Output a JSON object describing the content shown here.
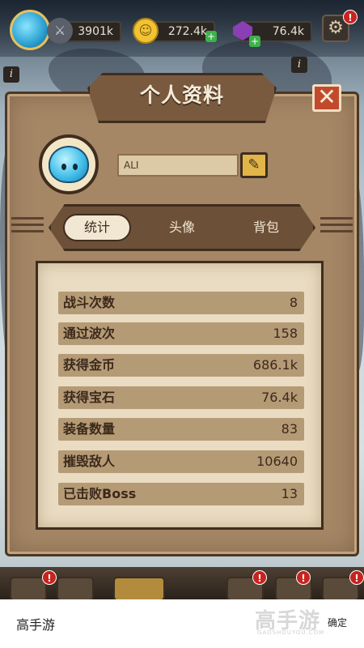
{
  "hud": {
    "power": "3901k",
    "coins": "272.4k",
    "gems": "76.4k",
    "alert": "!",
    "icons": {
      "power": "sword-icon",
      "coins": "coin-icon",
      "gems": "gem-icon",
      "settings": "gear-icon"
    }
  },
  "info": {
    "label": "i"
  },
  "dialog": {
    "title": "个人资料",
    "close_label": "✕",
    "player_name": "ALI",
    "edit_label": "✎"
  },
  "tabs": [
    {
      "label": "统计",
      "active": true
    },
    {
      "label": "头像",
      "active": false
    },
    {
      "label": "背包",
      "active": false
    }
  ],
  "stats": [
    {
      "label": "战斗次数",
      "value": "8"
    },
    {
      "label": "通过波次",
      "value": "158"
    },
    {
      "label": "获得金币",
      "value": "686.1k"
    },
    {
      "label": "获得宝石",
      "value": "76.4k"
    },
    {
      "label": "装备数量",
      "value": "83"
    },
    {
      "label": "摧毁敌人",
      "value": "10640"
    },
    {
      "label": "已击败Boss",
      "value": "13"
    }
  ],
  "footer": {
    "left": "高手游",
    "right": "确定",
    "watermark": "高手游",
    "watermark_sub": "GAOSHOUYOU.COM"
  },
  "colors": {
    "panel": "#a58766",
    "banner": "#7a5a3e",
    "close": "#c24a2c",
    "edit": "#e2b548",
    "alert": "#c8231f"
  }
}
